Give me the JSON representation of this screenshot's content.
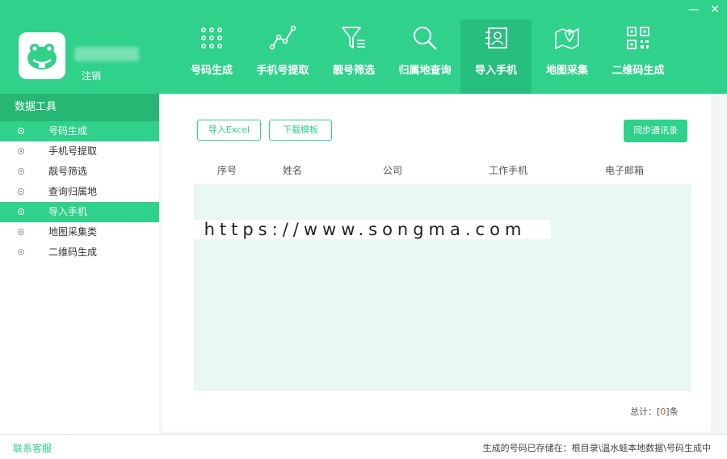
{
  "header": {
    "logout_label": "注销",
    "nav": [
      {
        "label": "号码生成",
        "icon": "dots-grid-icon"
      },
      {
        "label": "手机号提取",
        "icon": "line-chart-icon"
      },
      {
        "label": "靓号筛选",
        "icon": "filter-icon"
      },
      {
        "label": "归属地查询",
        "icon": "search-icon"
      },
      {
        "label": "导入手机",
        "icon": "contact-card-icon"
      },
      {
        "label": "地图采集",
        "icon": "map-pin-icon"
      },
      {
        "label": "二维码生成",
        "icon": "qr-code-icon"
      }
    ],
    "active_nav": 4
  },
  "sidebar": {
    "title": "数据工具",
    "items": [
      {
        "label": "号码生成"
      },
      {
        "label": "手机号提取"
      },
      {
        "label": "靓号筛选"
      },
      {
        "label": "查询归属地"
      },
      {
        "label": "导入手机"
      },
      {
        "label": "地图采集类"
      },
      {
        "label": "二维码生成"
      }
    ]
  },
  "toolbar": {
    "import_excel": "导入Excel",
    "download_template": "下载模板",
    "sync_contacts": "同步通讯录"
  },
  "table": {
    "columns": [
      "序号",
      "姓名",
      "公司",
      "工作手机",
      "电子邮箱"
    ]
  },
  "watermark": "https://www.songma.com",
  "total": {
    "prefix": "总计：[",
    "count": "0",
    "suffix": "]条"
  },
  "footer": {
    "contact": "联系客服",
    "status": "生成的号码已存储在：根目录\\温水蛙本地数据\\号码生成中"
  },
  "colors": {
    "accent": "#2fd18b",
    "accent_dark": "#26b775"
  }
}
